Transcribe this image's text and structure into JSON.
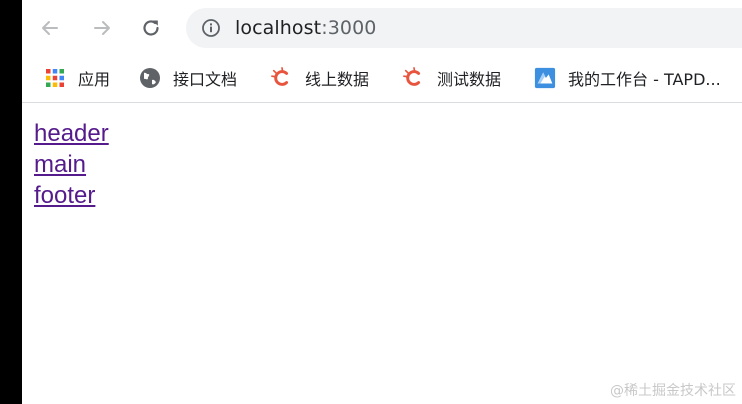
{
  "address_bar": {
    "host": "localhost",
    "port": ":3000"
  },
  "bookmarks": [
    {
      "label": "应用",
      "icon": "apps-grid-icon"
    },
    {
      "label": "接口文档",
      "icon": "globe-icon"
    },
    {
      "label": "线上数据",
      "icon": "spark-c-icon"
    },
    {
      "label": "测试数据",
      "icon": "spark-c-icon"
    },
    {
      "label": "我的工作台 - TAPD...",
      "icon": "tapd-icon"
    }
  ],
  "page_links": [
    "header",
    "main",
    "footer"
  ],
  "watermark": "@稀土掘金技术社区",
  "colors": {
    "link_visited": "#551a8b",
    "omnibox_bg": "#f1f3f4",
    "icon_gray": "#5f6368",
    "spark_red": "#e8553e",
    "tapd_blue": "#3d8fe0"
  }
}
